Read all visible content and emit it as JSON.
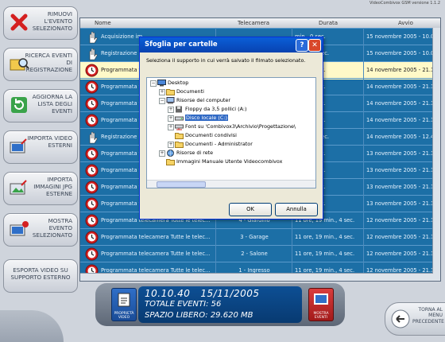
{
  "version": "VideoCombivox GSM versione 1.1.2",
  "sidebar": [
    {
      "label": "Rimuovi l'evento selezionato",
      "icon": "red-x-icon"
    },
    {
      "label": "Ricerca eventi di registrazione",
      "icon": "folder-search-icon"
    },
    {
      "label": "Aggiorna la lista degli eventi",
      "icon": "refresh-icon"
    },
    {
      "label": "Importa video esterni",
      "icon": "import-video-icon"
    },
    {
      "label": "Importa immagini JPG esterne",
      "icon": "import-image-icon"
    },
    {
      "label": "Mostra evento selezionato",
      "icon": "show-event-icon"
    },
    {
      "label": "Esporta video su supporto esterno",
      "icon": ""
    }
  ],
  "grid": {
    "headers": [
      "Nome",
      "Telecamera",
      "Durata",
      "Avvio"
    ],
    "rows": [
      {
        "icon": "hand",
        "nome": "Acquisizione im",
        "tel": "",
        "durata": "min., 0 sec.",
        "avvio": "15 novembre 2005 - 10.0"
      },
      {
        "icon": "hand",
        "nome": "Registrazione m",
        "tel": "",
        "durata": "min., 35 sec.",
        "avvio": "15 novembre 2005 - 10.0"
      },
      {
        "icon": "clock",
        "nome": "Programmata te",
        "tel": "",
        "durata": "min., 4 sec.",
        "avvio": "14 novembre 2005 - 21.1",
        "hl": true
      },
      {
        "icon": "clock",
        "nome": "Programmata te",
        "tel": "",
        "durata": "min., 4 sec.",
        "avvio": "14 novembre 2005 - 21.1"
      },
      {
        "icon": "clock",
        "nome": "Programmata te",
        "tel": "",
        "durata": "min., 4 sec.",
        "avvio": "14 novembre 2005 - 21.1"
      },
      {
        "icon": "clock",
        "nome": "Programmata te",
        "tel": "",
        "durata": "min., 4 sec.",
        "avvio": "14 novembre 2005 - 21.1"
      },
      {
        "icon": "hand",
        "nome": "Registrazione n",
        "tel": "",
        "durata": "min., 34 sec.",
        "avvio": "14 novembre 2005 - 12.4"
      },
      {
        "icon": "clock",
        "nome": "Programmata te",
        "tel": "",
        "durata": "min., 4 sec.",
        "avvio": "13 novembre 2005 - 21.1"
      },
      {
        "icon": "clock",
        "nome": "Programmata te",
        "tel": "",
        "durata": "min., 4 sec.",
        "avvio": "13 novembre 2005 - 21.1"
      },
      {
        "icon": "clock",
        "nome": "Programmata te",
        "tel": "",
        "durata": "min., 4 sec.",
        "avvio": "13 novembre 2005 - 21.1"
      },
      {
        "icon": "clock",
        "nome": "Programmata te",
        "tel": "",
        "durata": "min., 4 sec.",
        "avvio": "13 novembre 2005 - 21.1"
      },
      {
        "icon": "clock",
        "nome": "Programmata telecamera Tutte le telec...",
        "tel": "4 - Giardino",
        "durata": "11 ore, 19 min., 4 sec.",
        "avvio": "12 novembre 2005 - 21.1"
      },
      {
        "icon": "clock",
        "nome": "Programmata telecamera Tutte le telec...",
        "tel": "3 - Garage",
        "durata": "11 ore, 19 min., 4 sec.",
        "avvio": "12 novembre 2005 - 21.1"
      },
      {
        "icon": "clock",
        "nome": "Programmata telecamera Tutte le telec...",
        "tel": "2 - Salone",
        "durata": "11 ore, 19 min., 4 sec.",
        "avvio": "12 novembre 2005 - 21.1"
      },
      {
        "icon": "clock",
        "nome": "Programmata telecamera Tutte le telec...",
        "tel": "1 - Ingresso",
        "durata": "11 ore, 19 min., 4 sec.",
        "avvio": "12 novembre 2005 - 21.1"
      }
    ]
  },
  "status": {
    "time": "10.10.40",
    "date": "15/11/2005",
    "total": "TOTALE EVENTI: 56",
    "space": "SPAZIO LIBERO: 29.620 MB",
    "left_icon_label": "PROPRIETÀ VIDEO",
    "right_icon_label": "MOSTRA EVENTI"
  },
  "torna": "TORNA AL MENU PRECEDENTE",
  "dialog": {
    "title": "Sfoglia per cartelle",
    "help": "?",
    "close": "✕",
    "message": "Seleziona il supporto in cui verrà salvato il filmato selezionato.",
    "tree": [
      {
        "label": "Desktop",
        "pm": "−",
        "indent": 0,
        "icon": "desktop"
      },
      {
        "label": "Documenti",
        "pm": "+",
        "indent": 1,
        "icon": "folder"
      },
      {
        "label": "Risorse del computer",
        "pm": "−",
        "indent": 1,
        "icon": "computer"
      },
      {
        "label": "Floppy da 3,5 pollici (A:)",
        "pm": "+",
        "indent": 2,
        "icon": "floppy"
      },
      {
        "label": "Disco locale (C:)",
        "pm": "+",
        "indent": 2,
        "icon": "drive",
        "sel": true
      },
      {
        "label": "Font su 'Combivox3\\Archivio\\Progettazione\\",
        "pm": "+",
        "indent": 2,
        "icon": "netdrive"
      },
      {
        "label": "Documenti condivisi",
        "pm": "",
        "indent": 2,
        "icon": "folder"
      },
      {
        "label": "Documenti - Administrator",
        "pm": "+",
        "indent": 2,
        "icon": "folder"
      },
      {
        "label": "Risorse di rete",
        "pm": "+",
        "indent": 1,
        "icon": "network"
      },
      {
        "label": "Immagini Manuale Utente Videocombivox",
        "pm": "",
        "indent": 1,
        "icon": "folder"
      }
    ],
    "ok": "OK",
    "cancel": "Annulla"
  }
}
